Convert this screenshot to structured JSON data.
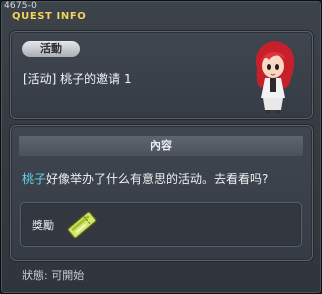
{
  "window": {
    "quest_id": "4675-0",
    "title": "QUEST INFO"
  },
  "quest": {
    "category_badge": "活動",
    "name": "[活动] 桃子的邀请 1"
  },
  "content": {
    "header": "內容",
    "npc_name": "桃子",
    "description": "好像举办了什么有意思的活动。去看看吗?"
  },
  "reward": {
    "label": "獎勵",
    "icon": "ticket-icon"
  },
  "status": {
    "text": "狀態:  可開始"
  },
  "colors": {
    "title": "#f4d35a",
    "npc_highlight": "#5fd6e8"
  }
}
